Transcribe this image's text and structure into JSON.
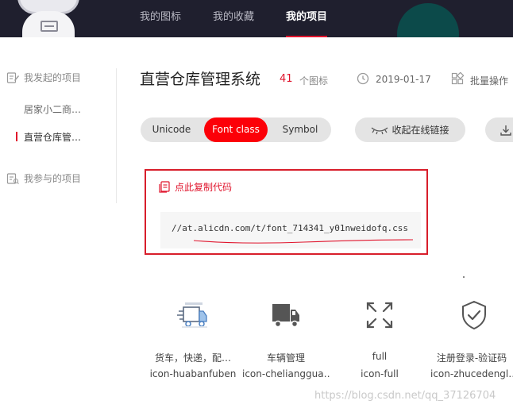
{
  "header": {
    "tabs": [
      {
        "label": "我的图标"
      },
      {
        "label": "我的收藏"
      },
      {
        "label": "我的项目",
        "active": true
      }
    ]
  },
  "sidebar": {
    "section_mine": "我发起的项目",
    "items": [
      {
        "label": "居家小二商…"
      },
      {
        "label": "直营仓库管…",
        "active": true
      }
    ],
    "section_join": "我参与的项目"
  },
  "project": {
    "title": "直营仓库管理系统",
    "count": "41",
    "count_unit": "个图标",
    "date": "2019-01-17",
    "batch_label": "批量操作"
  },
  "toolbar": {
    "modes": [
      "Unicode",
      "Font class",
      "Symbol"
    ],
    "selected_mode": "Font class",
    "collapse_label": "收起在线链接"
  },
  "code_panel": {
    "copy_label": "点此复制代码",
    "url": "//at.alicdn.com/t/font_714341_y01nweidofq.css"
  },
  "icons": [
    {
      "name": "货车，快递，配…",
      "code": "icon-huabanfuben"
    },
    {
      "name": "车辆管理",
      "code": "icon-chelianggua…"
    },
    {
      "name": "full",
      "code": "icon-full"
    },
    {
      "name": "注册登录-验证码",
      "code": "icon-zhucedengl…"
    }
  ],
  "watermark": "https://blog.csdn.net/qq_37126704",
  "colors": {
    "accent": "#fc0008",
    "header_bg": "#1f1f2e",
    "panel_border": "#d81e2b"
  }
}
